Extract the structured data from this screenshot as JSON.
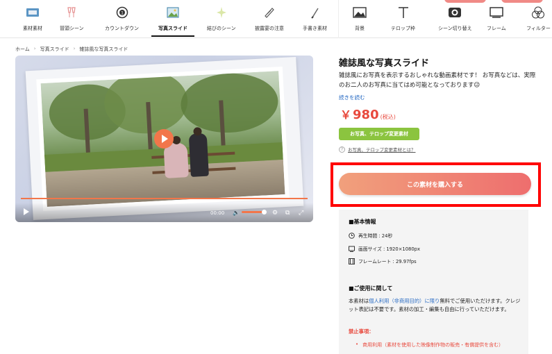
{
  "nav": {
    "items": [
      {
        "label": "素材素材",
        "icon": "video-clip-icon"
      },
      {
        "label": "冒頭シーン",
        "icon": "toast-glasses-icon"
      },
      {
        "label": "カウントダウン",
        "icon": "countdown-icon"
      },
      {
        "label": "写真スライド",
        "icon": "photo-slide-icon"
      },
      {
        "label": "結びのシーン",
        "icon": "sparkle-icon"
      },
      {
        "label": "披露宴の注意",
        "icon": "scroll-icon"
      },
      {
        "label": "手書き素材",
        "icon": "pen-icon"
      },
      {
        "label": "背景",
        "icon": "image-icon"
      },
      {
        "label": "テロップ枠",
        "icon": "text-t-icon"
      },
      {
        "label": "シーン切り替え",
        "icon": "transition-icon"
      },
      {
        "label": "フレーム",
        "icon": "frame-icon"
      },
      {
        "label": "フィルター",
        "icon": "filter-circles-icon"
      }
    ],
    "active_index": 3
  },
  "breadcrumb": {
    "home": "ホーム",
    "category": "写真スライド",
    "current": "雑誌風な写真スライド"
  },
  "player": {
    "time": "00:00",
    "volume_fraction": 0.85
  },
  "product": {
    "title": "雑誌風な写真スライド",
    "description": "雑誌風にお写真を表示するおしゃれな動画素材です！ お写真などは、実際のお二人のお写真に当てはめ可能となっております😉",
    "read_more": "続きを読む",
    "price_symbol": "￥",
    "price": "980",
    "tax_note": "(税込)",
    "edit_button": "お写真、テロップ変更素材",
    "help_link": "お写真、テロップ変更素材とは？",
    "buy_button": "この素材を購入する"
  },
  "info": {
    "basic_head": "■基本情報",
    "specs": [
      {
        "icon": "clock-icon",
        "text": "再生時間 : 24秒"
      },
      {
        "icon": "screen-size-icon",
        "text": "画面サイズ : 1920×1080px"
      },
      {
        "icon": "film-icon",
        "text": "フレームレート : 29.97fps"
      }
    ],
    "usage_head": "■ご使用に関して",
    "usage_pre": "本素材は",
    "usage_highlight": "個人利用（非商用目的）に限り",
    "usage_post": "無料でご使用いただけます。クレジット表記は不要です。素材の加工・編集も自由に行っていただけます。",
    "ban_head": "禁止事項：",
    "ban_item": "商用利用（素材を使用した映像制作物の販売・有償提供を含む）"
  },
  "colors": {
    "accent": "#e8493d",
    "green": "#8bc43f",
    "buy_gradient_start": "#f1a07c",
    "buy_gradient_end": "#ee6e6e",
    "highlight_border": "#ff0000"
  }
}
